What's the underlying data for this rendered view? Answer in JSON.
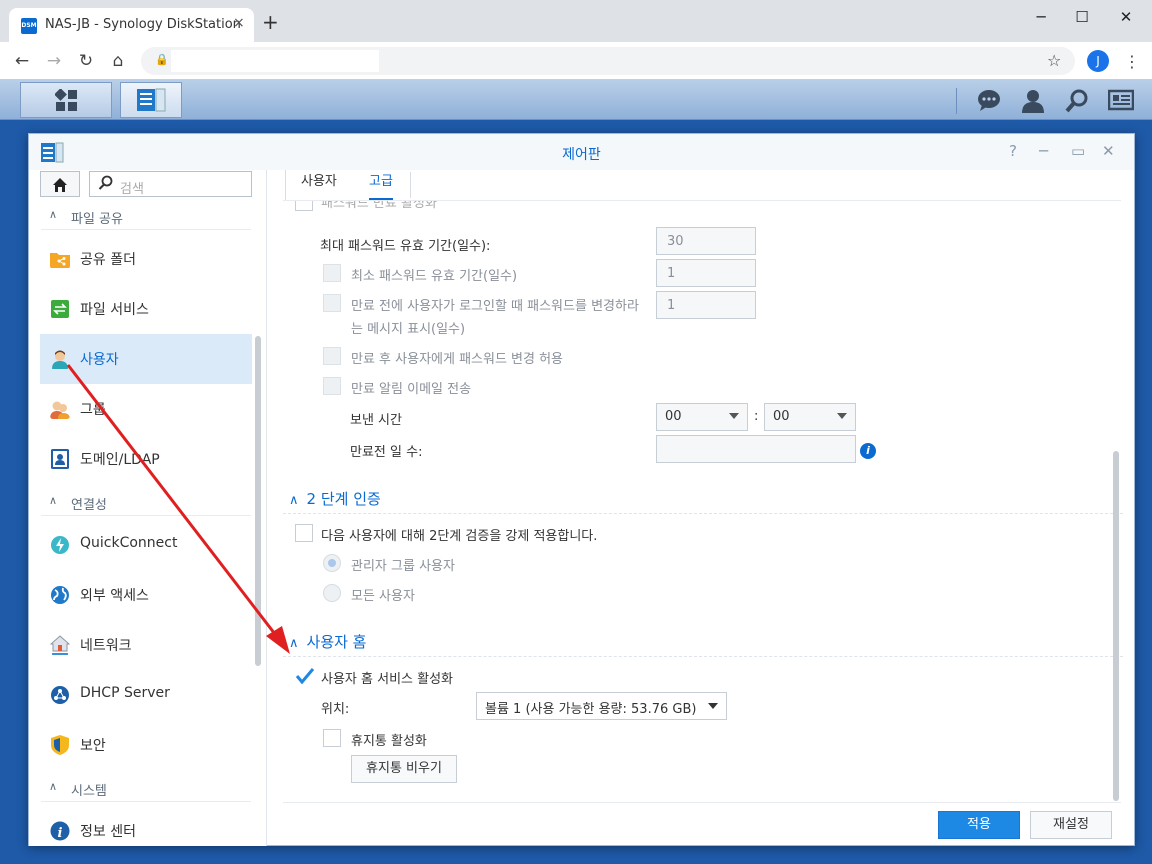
{
  "browser": {
    "tab_title": "NAS-JB - Synology DiskStation",
    "favicon_text": "DSM",
    "tab_close": "×",
    "new_tab": "+",
    "avatar_letter": "J",
    "window_controls": [
      "─",
      "☐",
      "✕"
    ]
  },
  "dsm_topbar": {
    "icons": [
      "chat-icon",
      "user-icon",
      "search-icon",
      "widgets-icon"
    ]
  },
  "window": {
    "title": "제어판",
    "controls": [
      "?",
      "─",
      "▭",
      "✕"
    ]
  },
  "sidebar": {
    "search_placeholder": "검색",
    "sections": [
      {
        "label": "파일 공유",
        "items": [
          "공유 폴더",
          "파일 서비스",
          "사용자",
          "그룹",
          "도메인/LDAP"
        ]
      },
      {
        "label": "연결성",
        "items": [
          "QuickConnect",
          "외부 액세스",
          "네트워크",
          "DHCP Server",
          "보안"
        ]
      },
      {
        "label": "시스템",
        "items": [
          "정보 센터"
        ]
      }
    ],
    "selected": "사용자"
  },
  "tabs": [
    "사용자",
    "고급"
  ],
  "active_tab": "고급",
  "password": {
    "cut_label": "패스워드 만료 활성화",
    "max_age_label": "최대 패스워드 유효 기간(일수):",
    "max_age_value": "30",
    "min_age_label": "최소 패스워드 유효 기간(일수)",
    "min_age_value": "1",
    "notify_label_1": "만료 전에 사용자가 로그인할 때 패스워드를 변경하라",
    "notify_label_2": "는 메시지 표시(일수)",
    "notify_value": "1",
    "allow_change_label": "만료 후 사용자에게 패스워드 변경 허용",
    "email_label": "만료 알림 이메일 전송",
    "send_time_label": "보낸 시간",
    "hour": "00",
    "minute": "00",
    "time_sep": ":",
    "days_before_label": "만료전 일 수:",
    "days_before_value": ""
  },
  "two_factor": {
    "header": "2 단계 인증",
    "enforce_label": "다음 사용자에 대해 2단계 검증을 강제 적용합니다.",
    "option_admin": "관리자 그룹 사용자",
    "option_all": "모든 사용자"
  },
  "user_home": {
    "header": "사용자 홈",
    "enable_label": "사용자 홈 서비스 활성화",
    "enabled": true,
    "location_label": "위치:",
    "location_value": "볼륨 1 (사용 가능한 용량:  53.76 GB)",
    "recycle_label": "휴지통 활성화",
    "empty_recycle_button": "휴지통 비우기"
  },
  "footer": {
    "apply": "적용",
    "reset": "재설정"
  },
  "colors": {
    "accent": "#0a6ad0",
    "annotation_arrow": "#e02020"
  }
}
